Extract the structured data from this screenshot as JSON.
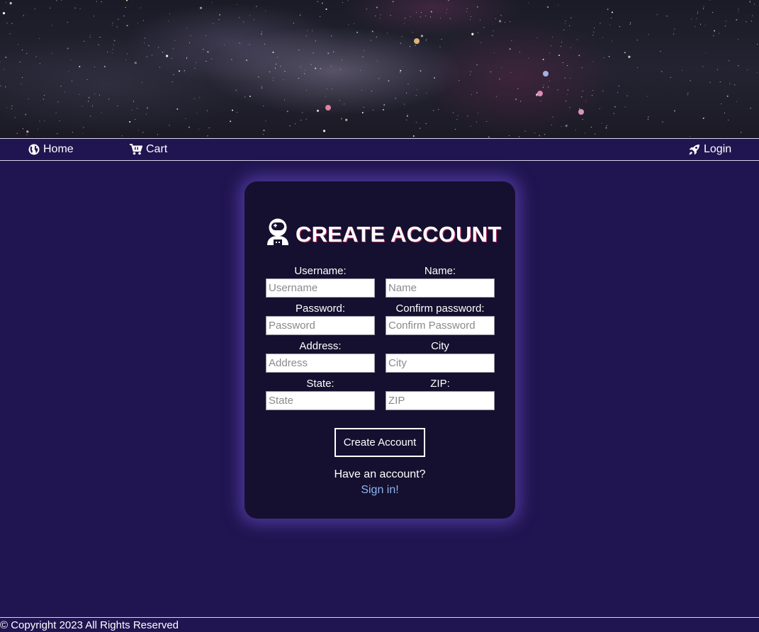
{
  "nav": {
    "home_label": "Home",
    "home_icon": "globe-icon",
    "cart_label": "Cart",
    "cart_icon": "cart-icon",
    "login_label": "Login",
    "login_icon": "rocket-icon"
  },
  "form": {
    "title": "CREATE ACCOUNT",
    "title_icon": "astronaut-icon",
    "fields": {
      "username": {
        "label": "Username:",
        "placeholder": "Username",
        "value": ""
      },
      "name": {
        "label": "Name:",
        "placeholder": "Name",
        "value": ""
      },
      "password": {
        "label": "Password:",
        "placeholder": "Password",
        "value": ""
      },
      "confirm_password": {
        "label": "Confirm password:",
        "placeholder": "Confirm Password",
        "value": ""
      },
      "address": {
        "label": "Address:",
        "placeholder": "Address",
        "value": ""
      },
      "city": {
        "label": "City",
        "placeholder": "City",
        "value": ""
      },
      "state": {
        "label": "State:",
        "placeholder": "State",
        "value": ""
      },
      "zip": {
        "label": "ZIP:",
        "placeholder": "ZIP",
        "value": ""
      }
    },
    "submit_label": "Create Account",
    "have_account_text": "Have an account?",
    "signin_link": "Sign in!"
  },
  "footer": {
    "copyright": "© Copyright 2023 All Rights Reserved"
  },
  "colors": {
    "page_background": "#201550",
    "card_background": "#15102f",
    "card_glow": "#6e50d2",
    "link": "#8fb4f2",
    "title_shadow": "#d0306a"
  }
}
